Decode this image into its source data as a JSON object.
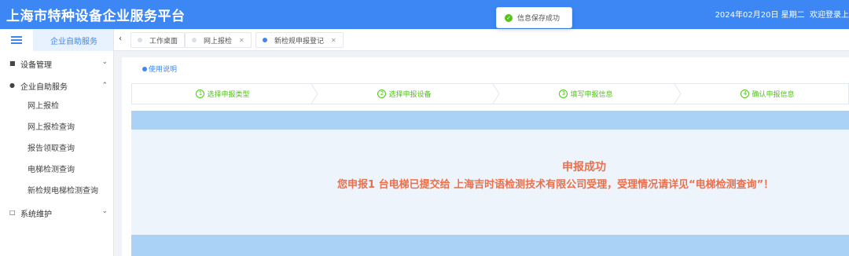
{
  "header": {
    "title": "上海市特种设备企业服务平台",
    "date_text": "2024年02月20日 星期二",
    "welcome_text": "欢迎登录上"
  },
  "toast": {
    "icon": "check-circle-icon",
    "message": "信息保存成功"
  },
  "sidebar": {
    "toggle_icon": "menu-fold-icon",
    "active_tab": "企业自助服务",
    "menu": [
      {
        "label": "设备管理",
        "icon": "briefcase-icon",
        "expanded": false
      },
      {
        "label": "企业自助服务",
        "icon": "gear-icon",
        "expanded": true,
        "children": [
          "网上报检",
          "网上报检查询",
          "报告领取查询",
          "电梯检测查询",
          "新检规电梯检测查询"
        ]
      },
      {
        "label": "系统维护",
        "icon": "monitor-icon",
        "expanded": false
      }
    ]
  },
  "tabs": [
    {
      "label": "工作桌面",
      "closable": false,
      "active": false
    },
    {
      "label": "网上报检",
      "closable": true,
      "active": false
    },
    {
      "label": "新检规申报登记",
      "closable": true,
      "active": true
    }
  ],
  "content": {
    "help_link": "使用说明",
    "steps": [
      {
        "num": "1",
        "label": "选择申报类型"
      },
      {
        "num": "2",
        "label": "选择申报设备"
      },
      {
        "num": "3",
        "label": "填写申报信息"
      },
      {
        "num": "4",
        "label": "确认申报信息"
      }
    ],
    "success_title": "申报成功",
    "success_message": "您申报1 台电梯已提交给 上海吉时语检测技术有限公司受理，受理情况请详见“电梯检测查询”！"
  },
  "colors": {
    "brand": "#3d87f5",
    "step_green": "#52c41a",
    "success_text": "#ec6f4b",
    "band": "#aad2f7"
  }
}
